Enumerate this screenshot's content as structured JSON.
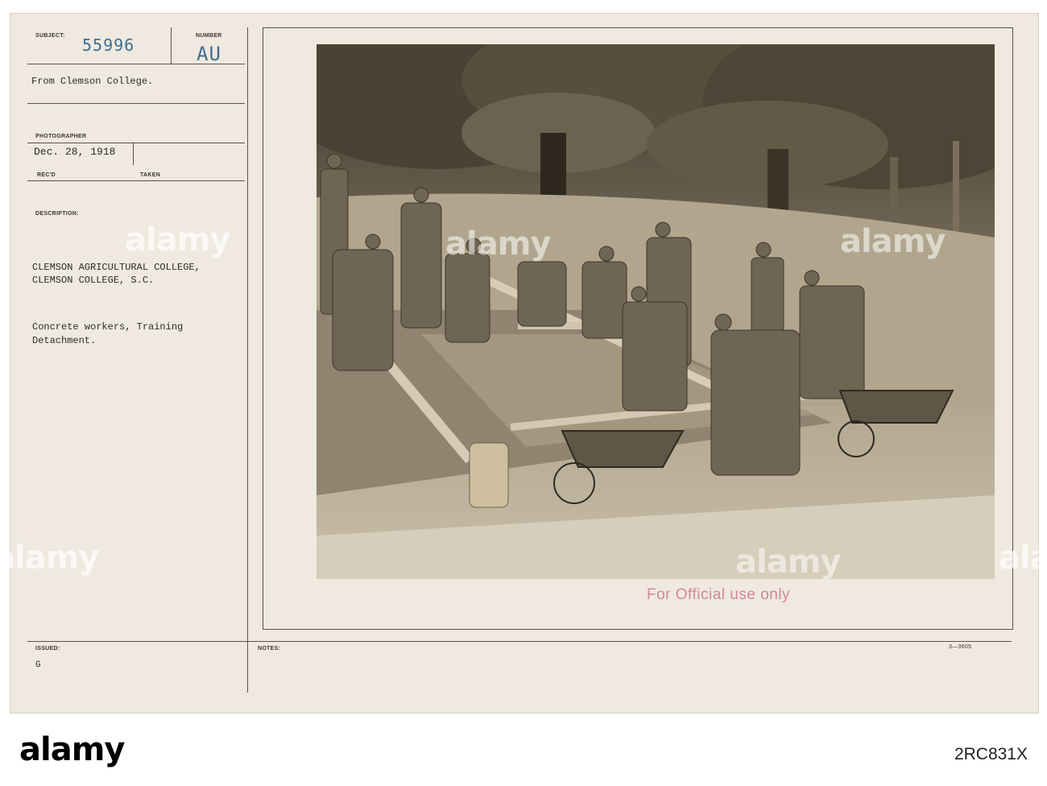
{
  "card": {
    "subject_label": "SUBJECT:",
    "subject_value": "55996",
    "number_label": "NUMBER",
    "number_value": "AU",
    "source": "From Clemson College.",
    "photographer_label": "PHOTOGRAPHER",
    "date_value": "Dec. 28, 1918",
    "recd_label": "REC'D",
    "taken_label": "TAKEN",
    "description_label": "DESCRIPTION:",
    "description_line1": "CLEMSON AGRICULTURAL COLLEGE,",
    "description_line2": "CLEMSON COLLEGE, S.C.",
    "caption_line1": "Concrete workers, Training",
    "caption_line2": "Detachment.",
    "issued_label": "ISSUED:",
    "issued_value": "G",
    "notes_label": "NOTES:",
    "form_code": "3—3605",
    "stamp": "For Official use only"
  },
  "watermark": "alamy",
  "footer": {
    "logo": "alamy",
    "image_id": "2RC831X"
  },
  "colors": {
    "card": "#efe9df",
    "stamp_blue": "#3f6e93",
    "stamp_pink": "#d4869a",
    "sepia_dark": "#3b3326"
  }
}
